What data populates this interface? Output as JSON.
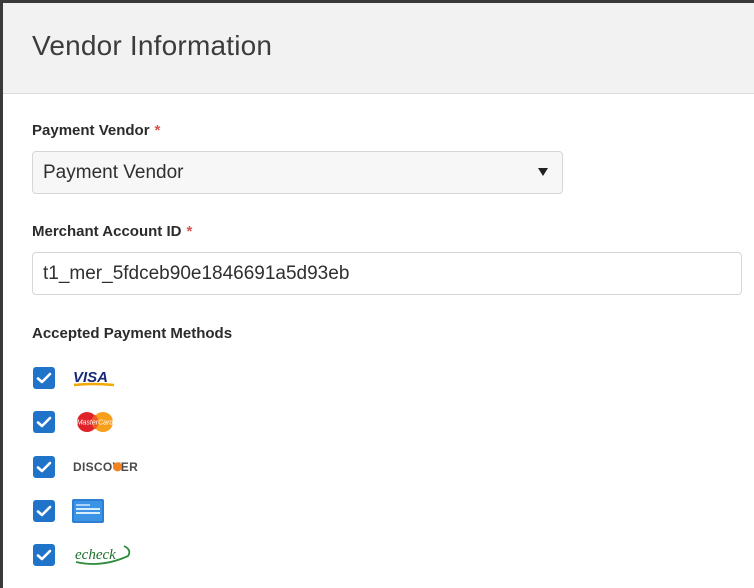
{
  "panel": {
    "title": "Vendor Information"
  },
  "payment_vendor": {
    "label": "Payment Vendor",
    "required_mark": "*",
    "selected_value": "Payment Vendor"
  },
  "merchant_account": {
    "label": "Merchant Account ID",
    "required_mark": "*",
    "value": "t1_mer_5fdceb90e1846691a5d93eb"
  },
  "accepted_methods": {
    "label": "Accepted Payment Methods",
    "items": [
      {
        "name": "visa",
        "logo_text": "VISA",
        "checked": true,
        "icon": "visa-logo"
      },
      {
        "name": "mastercard",
        "logo_text": "MasterCard",
        "checked": true,
        "icon": "mastercard-logo"
      },
      {
        "name": "discover",
        "logo_text": "DISCOVER",
        "checked": true,
        "icon": "discover-logo"
      },
      {
        "name": "amex",
        "logo_text": "",
        "checked": true,
        "icon": "amex-logo"
      },
      {
        "name": "echeck",
        "logo_text": "echeck",
        "checked": true,
        "icon": "echeck-logo"
      }
    ]
  },
  "colors": {
    "checkbox": "#1f73c9",
    "required": "#d9534f",
    "header_bg": "#f2f2f2"
  }
}
